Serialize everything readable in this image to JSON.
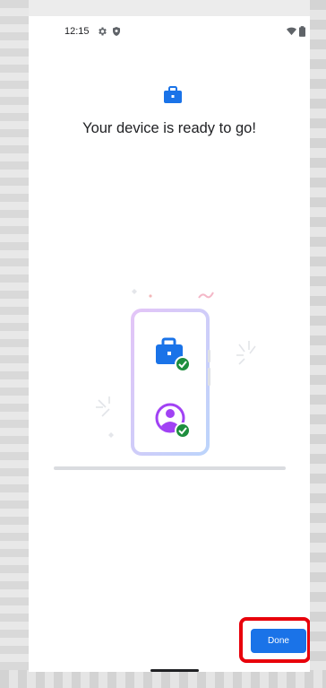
{
  "status_bar": {
    "time": "12:15",
    "icons": [
      "gear-icon",
      "shield-icon",
      "wifi-icon",
      "battery-icon"
    ]
  },
  "header": {
    "icon": "briefcase-icon",
    "title": "Your device is ready to go!"
  },
  "illustration": {
    "icons": [
      "briefcase-check-icon",
      "person-check-icon"
    ],
    "colors": {
      "briefcase": "#1a73e8",
      "person": "#a142f4",
      "check": "#1e8e3e"
    }
  },
  "footer": {
    "done_label": "Done",
    "accent": "#1a73e8",
    "highlight": "#e8000b"
  }
}
